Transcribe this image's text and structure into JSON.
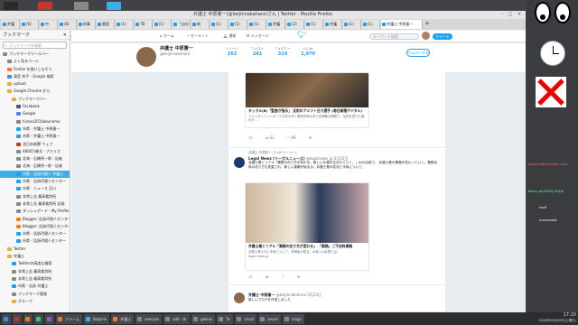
{
  "window": {
    "title": "弁護士 中原憲一(@keijinnakahara)さん | Twitter - Mozilla Firefox"
  },
  "tabs": [
    {
      "label": "弁護"
    },
    {
      "label": "(6)"
    },
    {
      "label": "中"
    },
    {
      "label": "(8)"
    },
    {
      "label": "刑事"
    },
    {
      "label": "異変"
    },
    {
      "label": "(1)"
    },
    {
      "label": "TB"
    },
    {
      "label": "(1)"
    },
    {
      "label": "「自分で"
    },
    {
      "label": "新"
    },
    {
      "label": "(1)"
    },
    {
      "label": "(1)"
    },
    {
      "label": "(1)"
    },
    {
      "label": "弁護"
    },
    {
      "label": "(2)"
    },
    {
      "label": "(1)"
    },
    {
      "label": "弁護"
    },
    {
      "label": "(1)"
    },
    {
      "label": "(1)"
    },
    {
      "label": "弁護士 中原憲一"
    }
  ],
  "nav": {
    "url": "https://twitter.com/keijinnakahara",
    "search_placeholder": "検索"
  },
  "sidebar": {
    "title": "ブックマーク",
    "search_placeholder": "ブックマークを検索",
    "items": [
      {
        "label": "ブックマークツールバー",
        "color": "#888888"
      },
      {
        "label": "よく見るページ",
        "color": "#888888"
      },
      {
        "label": "Firefox を使いこなそう",
        "color": "#ff7139"
      },
      {
        "label": "清宮 幸子 - Google 検索",
        "color": "#4285f4"
      },
      {
        "label": "upload",
        "color": "#e0b040"
      },
      {
        "label": "Google Chrome から",
        "color": "#e0b040"
      },
      {
        "label": "ブックマークバー",
        "color": "#e0b040"
      },
      {
        "label": "Facebook",
        "color": "#3b5998"
      },
      {
        "label": "Google",
        "color": "#4285f4"
      },
      {
        "label": "hirano2014akunomo",
        "color": "#888888"
      },
      {
        "label": "市県 - 弁護士 中原憲一",
        "color": "#1da1f2"
      },
      {
        "label": "市県 - 弁護士 中原憲一",
        "color": "#1da1f2"
      },
      {
        "label": "北日本新聞 ウェブ",
        "color": "#c0392b"
      },
      {
        "label": "4800万株式 - アメリカ",
        "color": "#888888"
      },
      {
        "label": "北海 - 石橋秀一郎 - 記者",
        "color": "#888888"
      },
      {
        "label": "北海 - 石橋秀一郎 - 記者",
        "color": "#888888"
      },
      {
        "label": "市県 - 告訴代理人 弁護士",
        "color": "#1da1f2"
      },
      {
        "label": "市県 - 告訴代理人センター",
        "color": "#1da1f2"
      },
      {
        "label": "市県 - ニュース 石川",
        "color": "#1da1f2"
      },
      {
        "label": "非常上告 最高裁判所",
        "color": "#888888"
      },
      {
        "label": "非常上告 最高裁判所 記録",
        "color": "#888888"
      },
      {
        "label": "ダッシュボード - My Profile",
        "color": "#888888"
      },
      {
        "label": "Blogger: 告訴代理人センター",
        "color": "#f57d00"
      },
      {
        "label": "Blogger: 告訴代理人センター",
        "color": "#f57d00"
      },
      {
        "label": "市県 - 告訴代理人センター",
        "color": "#1da1f2"
      },
      {
        "label": "市県 - 告訴代理人センター",
        "color": "#1da1f2"
      },
      {
        "label": "Twitter",
        "color": "#e0b040"
      },
      {
        "label": "弁護士",
        "color": "#e0b040"
      },
      {
        "label": "Twitterの高度な検索",
        "color": "#1da1f2"
      },
      {
        "label": "非常上告 最高裁判所",
        "color": "#888888"
      },
      {
        "label": "非常上告 最高裁判所",
        "color": "#888888"
      },
      {
        "label": "市県 - 告訴 弁護士",
        "color": "#1da1f2"
      },
      {
        "label": "ブックマーク管理",
        "color": "#888888"
      },
      {
        "label": "グループ",
        "color": "#e0b040"
      }
    ],
    "selected_index": 16
  },
  "twitter": {
    "nav": {
      "home": "ホーム",
      "moments": "モーメント",
      "notifications": "通知",
      "messages": "メッセージ",
      "search_placeholder": "キーワード検索",
      "tweet_button": "ツイート"
    },
    "profile": {
      "name": "弁護士 中原憲一",
      "handle": "@keijinnakahara",
      "stats": [
        {
          "label": "ツイート",
          "value": "262"
        },
        {
          "label": "フォロー",
          "value": "241"
        },
        {
          "label": "フォロワー",
          "value": "314"
        },
        {
          "label": "いいね",
          "value": "1,970"
        }
      ],
      "follow_button": "フォローする"
    },
    "tweet1": {
      "card_title": "タックル(B)「監督が指示」 反則のアメフト日大選手 (毎日新聞デジタル)",
      "card_desc": "アメリカンフットボール日本大学と関西学院大学の定期戦の問題で、反則を受けた選手が…",
      "card_domain": "mainichi.jp",
      "reply": "",
      "retweets": "21",
      "likes": "66"
    },
    "tweet2": {
      "retweet_note": "弁護士 中原憲一 さんがリツイート",
      "name": "Legal News (リーガルニュース)",
      "handle": "@legalnews_jp",
      "time": "5月22日",
      "text": "弁護士業とリアル「業務の在り方が変わる。新しい仕事が生まれていく。」AIの活用で、 弁護士業の業務が変わっていく。業務全体のあり方も見直され、新しい挑戦が始まる。弁護士業の変化と今後について。",
      "card_title": "弁護士業とリアル「業務の在り方が変わる」 「業務」ご不在料業務",
      "card_desc": "弁護士業の今と未来について、有識者が語る。AI導入の影響とは。",
      "card_domain": "legal-news.jp"
    },
    "tweet3": {
      "name": "弁護士 中原憲一",
      "handle": "@keijinnakahara",
      "time": "5月23日",
      "text": "新しいブログを作成しました"
    }
  },
  "desktop": {
    "notes": [
      "tweet-x68-mrp@w-uno.f",
      "Kamy-wp2018y-2018/",
      "kw:fi",
      "screenshot"
    ]
  },
  "taskbar": {
    "items": [
      {
        "label": "",
        "color": "#3d8be0"
      },
      {
        "label": "",
        "color": "#c0392b"
      },
      {
        "label": "",
        "color": "#e67e22"
      },
      {
        "label": "",
        "color": "#2ecc71"
      },
      {
        "label": "",
        "color": "#9b59b6"
      },
      {
        "label": "アラーム",
        "color": "#e67e22"
      },
      {
        "label": "Dolphin",
        "color": "#3daee9"
      },
      {
        "label": "弁護士",
        "color": "#ff7139"
      },
      {
        "label": "execute",
        "color": "#888888"
      },
      {
        "label": "a46 - br",
        "color": "#888888"
      },
      {
        "label": "@kosa",
        "color": "#888888"
      },
      {
        "label": "Tk",
        "color": "#888888"
      },
      {
        "label": ":clock",
        "color": "#888888"
      },
      {
        "label": "xeyes",
        "color": "#888888"
      },
      {
        "label": "xlogo",
        "color": "#888888"
      }
    ],
    "time": "17:10",
    "date": "2018年05月26日(土曜日)"
  }
}
